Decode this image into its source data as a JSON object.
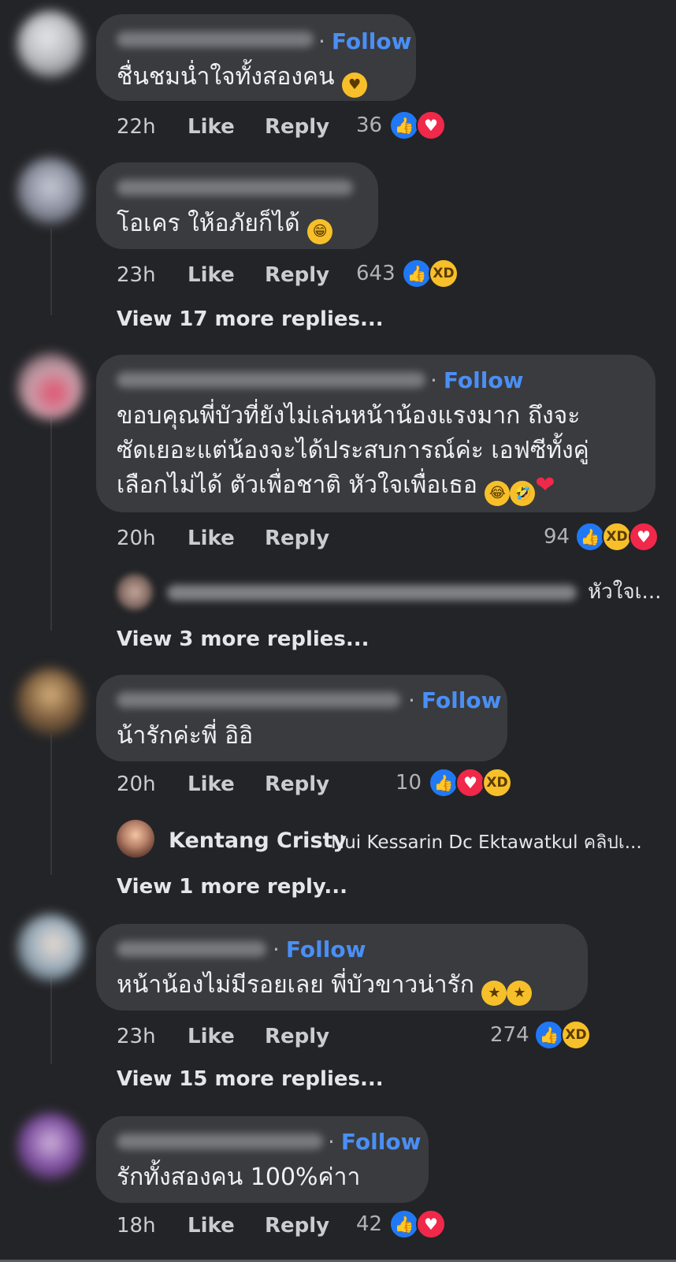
{
  "labels": {
    "follow": "Follow",
    "like": "Like",
    "reply": "Reply"
  },
  "comments": [
    {
      "text": "ชื่นชมน่ำใจทั้งสองคน",
      "time": "22h",
      "count": "36",
      "reactions": [
        "like",
        "love"
      ]
    },
    {
      "text": "โอเคร ให้อภัยก็ได้",
      "time": "23h",
      "count": "643",
      "reactions": [
        "like",
        "haha"
      ],
      "view_more": "View 17 more replies..."
    },
    {
      "text_lines": [
        "ขอบคุณพี่บัวที่ยังไม่เล่นหน้าน้องแรงมาก ถึงจะ",
        "ซัดเยอะแต่น้องจะได้ประสบการณ์ค่ะ เอฟซีทั้งคู่",
        "เลือกไม่ได้ ตัวเพื่อชาติ หัวใจเพื่อเธอ"
      ],
      "time": "20h",
      "count": "94",
      "reactions": [
        "like",
        "haha",
        "love"
      ],
      "reply_preview": "หัวใจเ...",
      "view_more": "View 3 more replies..."
    },
    {
      "text": "น้ารักค่ะพี่ อิอิ",
      "time": "20h",
      "count": "10",
      "reactions": [
        "like",
        "love",
        "haha"
      ],
      "reply_preview": {
        "author": "Kentang Cristy",
        "text": "Nui Kessarin Dc Ektawatkul คลิปเ..."
      },
      "view_more": "View 1 more reply..."
    },
    {
      "text": "หน้าน้องไม่มีรอยเลย พี่บัวขาวน่ารัก",
      "time": "23h",
      "count": "274",
      "reactions": [
        "like",
        "haha"
      ],
      "view_more": "View 15 more replies..."
    },
    {
      "text": "รักทั้งสองคน 100%ค่าา",
      "time": "18h",
      "count": "42",
      "reactions": [
        "like",
        "love"
      ]
    }
  ],
  "icons": {
    "like": "thumbs-up-icon",
    "love": "heart-icon",
    "haha": "laughing-face-icon"
  },
  "colors": {
    "background": "#232427",
    "bubble": "#3a3b3e",
    "follow": "#4a8ff6",
    "like": "#2078f4",
    "love": "#f0284a",
    "haha": "#f7c02a"
  }
}
